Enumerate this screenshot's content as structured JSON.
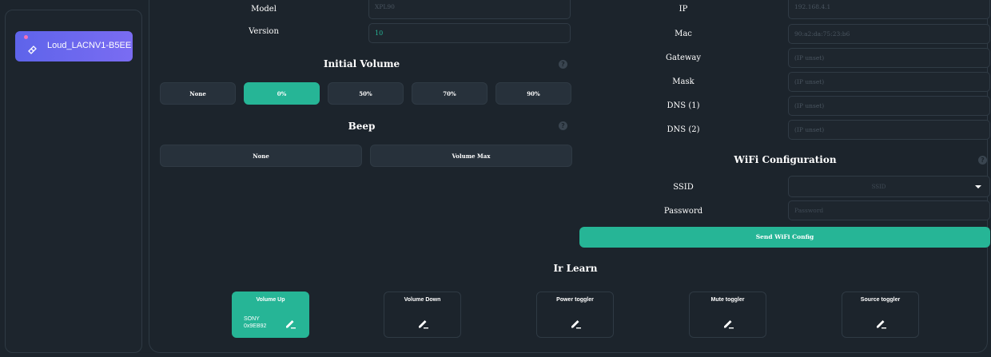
{
  "sidebar": {
    "device": {
      "label": "Loud_LACNV1-B5EE"
    }
  },
  "info": {
    "model_label": "Model",
    "model_value": "XPL90",
    "version_label": "Version",
    "version_value": "10"
  },
  "network": {
    "ip_label": "IP",
    "ip_value": "192.168.4.1",
    "mac_label": "Mac",
    "mac_value": "90:a2:da:75:23:b6",
    "gateway_label": "Gateway",
    "gateway_value": "(IP unset)",
    "mask_label": "Mask",
    "mask_value": "(IP unset)",
    "dns1_label": "DNS (1)",
    "dns1_value": "(IP unset)",
    "dns2_label": "DNS (2)",
    "dns2_value": "(IP unset)"
  },
  "initial_volume": {
    "title": "Initial Volume",
    "help": "?",
    "options": [
      "None",
      "0%",
      "50%",
      "70%",
      "90%"
    ],
    "selected": "0%"
  },
  "beep": {
    "title": "Beep",
    "help": "?",
    "options": [
      "None",
      "Volume Max"
    ]
  },
  "wifi": {
    "title": "WiFi Configuration",
    "help": "?",
    "ssid_label": "SSID",
    "ssid_placeholder": "SSID",
    "password_label": "Password",
    "password_placeholder": "Password",
    "send_button": "Send WiFi Config"
  },
  "ir_learn": {
    "title": "Ir Learn",
    "cards": [
      {
        "title": "Volume Up",
        "learned_brand": "SONY",
        "learned_code": "0x9EB92"
      },
      {
        "title": "Volume Down"
      },
      {
        "title": "Power toggler"
      },
      {
        "title": "Mute toggler"
      },
      {
        "title": "Source toggler"
      }
    ]
  },
  "colors": {
    "accent": "#26b596",
    "device_card": "#6366f1",
    "background": "#1c242c"
  }
}
